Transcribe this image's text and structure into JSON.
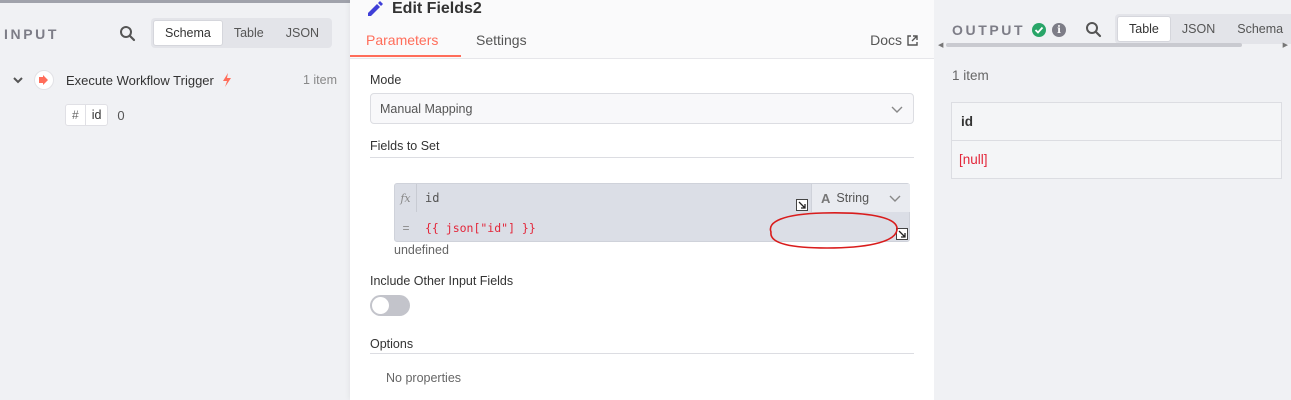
{
  "input": {
    "title": "INPUT",
    "view_tabs": [
      "Schema",
      "Table",
      "JSON"
    ],
    "active_tab": "Schema",
    "node": {
      "label": "Execute Workflow Trigger",
      "item_count": "1 item"
    },
    "schema_field": {
      "type_symbol": "#",
      "key": "id",
      "value": "0"
    }
  },
  "editor": {
    "title": "Edit Fields2",
    "tabs": {
      "parameters": "Parameters",
      "settings": "Settings",
      "docs": "Docs"
    },
    "mode_label": "Mode",
    "mode_value": "Manual Mapping",
    "fields_label": "Fields to Set",
    "assignment": {
      "fx": "fx",
      "name": "id",
      "type": "String",
      "type_icon": "A",
      "equals": "=",
      "value": "{{ json[\"id\"] }}",
      "hint": "undefined"
    },
    "include_label": "Include Other Input Fields",
    "include_enabled": false,
    "options_label": "Options",
    "options_empty": "No properties"
  },
  "output": {
    "title": "OUTPUT",
    "info_symbol": "i",
    "view_tabs": [
      "Table",
      "JSON",
      "Schema"
    ],
    "active_tab": "Table",
    "item_count": "1 item",
    "table": {
      "column": "id",
      "cell": "[null]"
    },
    "scroll_left": "◀",
    "scroll_right": "▶"
  },
  "colors": {
    "accent": "#ff6d5a",
    "error_text": "#e3263a",
    "success": "#29a568",
    "annotation": "#d91c1c"
  }
}
